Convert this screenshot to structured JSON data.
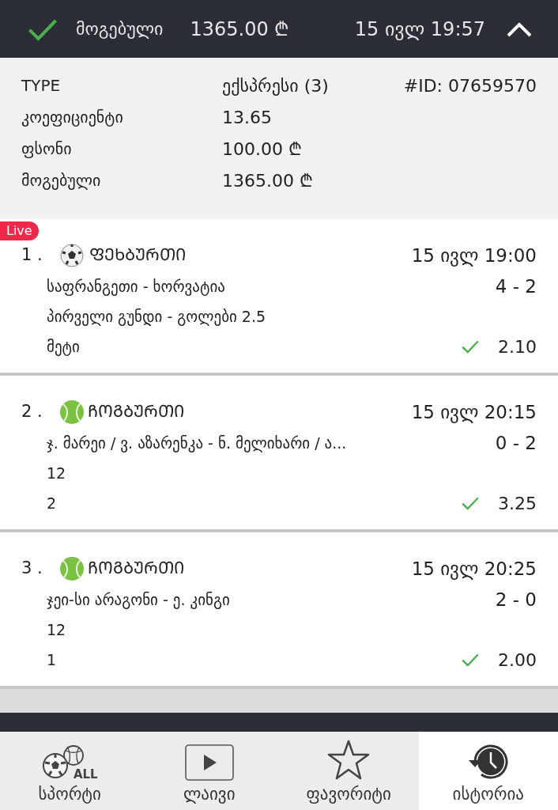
{
  "header": {
    "won": true,
    "status_label": "მოგებული",
    "amount": "1365.00 ₾",
    "datetime": "15 ივლ 19:57",
    "expanded": true
  },
  "details": {
    "type_label": "TYPE",
    "type_value": "ექსპრესი (3)",
    "id": "#ID: 07659570",
    "rows": [
      {
        "label": "კოეფიციენტი",
        "value": "13.65"
      },
      {
        "label": "ფსონი",
        "value": "100.00 ₾"
      },
      {
        "label": "მოგებული",
        "value": "1365.00 ₾"
      }
    ]
  },
  "events": [
    {
      "number": "1 .",
      "live": true,
      "live_label": "Live",
      "kind": "football",
      "sport_name": "ᲤᲔᲮᲑᲣᲠᲗᲘ",
      "datetime": "15 ივლ 19:00",
      "match": "საფრანგეთი - ხორვატია",
      "score": "4 - 2",
      "market": "პირველი გუნდი - გოლები 2.5",
      "pick": "მეტი",
      "won": true,
      "odds": "2.10"
    },
    {
      "number": "2 .",
      "live": false,
      "kind": "tennis",
      "sport_name": "ᲩᲝᲒᲑᲣᲠᲗᲘ",
      "datetime": "15 ივლ 20:15",
      "match": "ჯ. მარეი / ვ. აზარენკა - ნ. მელიხარი / ა...",
      "score": "0 - 2",
      "market": "12",
      "pick": "2",
      "won": true,
      "odds": "3.25"
    },
    {
      "number": "3 .",
      "live": false,
      "kind": "tennis",
      "sport_name": "ᲩᲝᲒᲑᲣᲠᲗᲘ",
      "datetime": "15 ივლ 20:25",
      "match": "ჯეი-სი არაგონი - ე. კინგი",
      "score": "2 - 0",
      "market": "12",
      "pick": "1",
      "won": true,
      "odds": "2.00"
    }
  ],
  "nav": [
    {
      "kind": "sports",
      "label": "სპორტი",
      "icon_text": "ALL",
      "selected": false
    },
    {
      "kind": "live",
      "label": "ლაივი",
      "selected": false
    },
    {
      "kind": "favorites",
      "label": "ფავორიტი",
      "selected": false
    },
    {
      "kind": "history",
      "label": "ისტორია",
      "selected": true
    }
  ]
}
